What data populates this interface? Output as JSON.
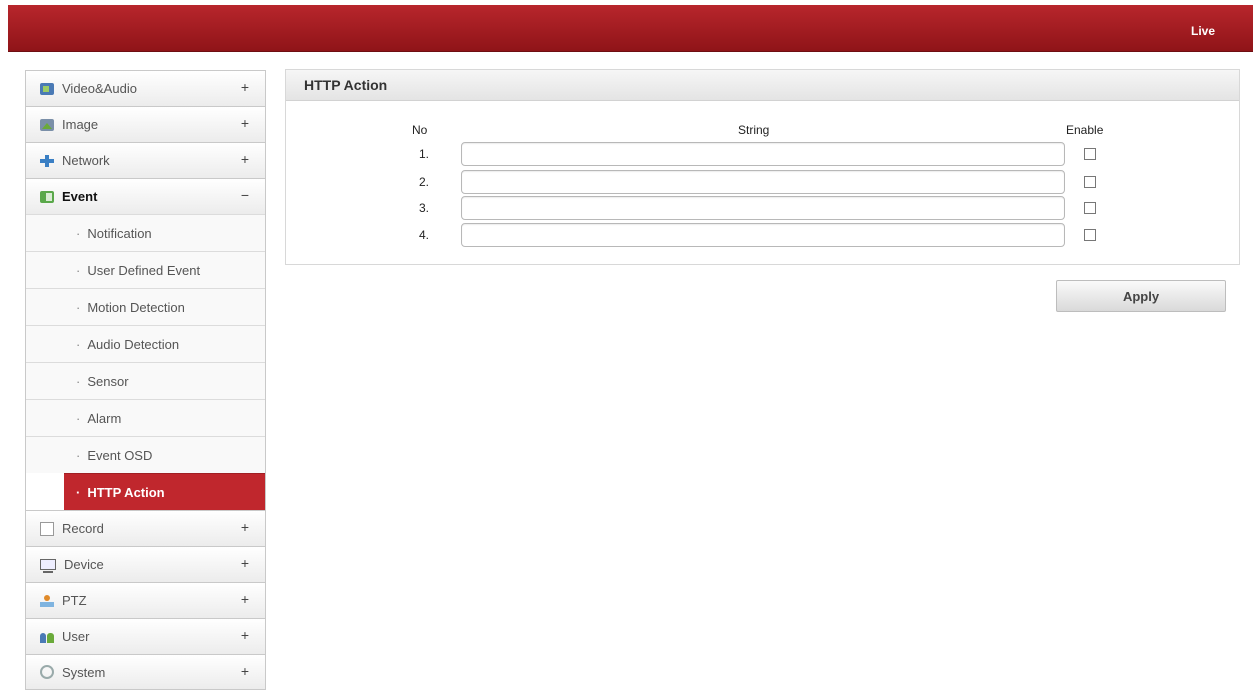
{
  "topbar": {
    "live_label": "Live"
  },
  "sidebar": {
    "items": [
      {
        "label": "Video&Audio",
        "toggle": "+",
        "icon": "video-audio-icon"
      },
      {
        "label": "Image",
        "toggle": "+",
        "icon": "image-icon"
      },
      {
        "label": "Network",
        "toggle": "+",
        "icon": "network-icon"
      },
      {
        "label": "Event",
        "toggle": "−",
        "icon": "event-icon"
      },
      {
        "label": "Record",
        "toggle": "+",
        "icon": "record-icon"
      },
      {
        "label": "Device",
        "toggle": "+",
        "icon": "device-icon"
      },
      {
        "label": "PTZ",
        "toggle": "+",
        "icon": "ptz-icon"
      },
      {
        "label": "User",
        "toggle": "+",
        "icon": "user-icon"
      },
      {
        "label": "System",
        "toggle": "+",
        "icon": "system-icon"
      }
    ],
    "event_submenu": [
      "Notification",
      "User Defined Event",
      "Motion Detection",
      "Audio Detection",
      "Sensor",
      "Alarm",
      "Event OSD",
      "HTTP Action"
    ],
    "active_submenu": "HTTP Action"
  },
  "panel": {
    "title": "HTTP Action",
    "columns": {
      "no": "No",
      "string": "String",
      "enable": "Enable"
    },
    "rows": [
      {
        "no": "1.",
        "value": "",
        "enabled": false
      },
      {
        "no": "2.",
        "value": "",
        "enabled": false
      },
      {
        "no": "3.",
        "value": "",
        "enabled": false
      },
      {
        "no": "4.",
        "value": "",
        "enabled": false
      }
    ]
  },
  "actions": {
    "apply_label": "Apply"
  },
  "colors": {
    "brand_red": "#b8262c",
    "active_red": "#c0272d"
  }
}
